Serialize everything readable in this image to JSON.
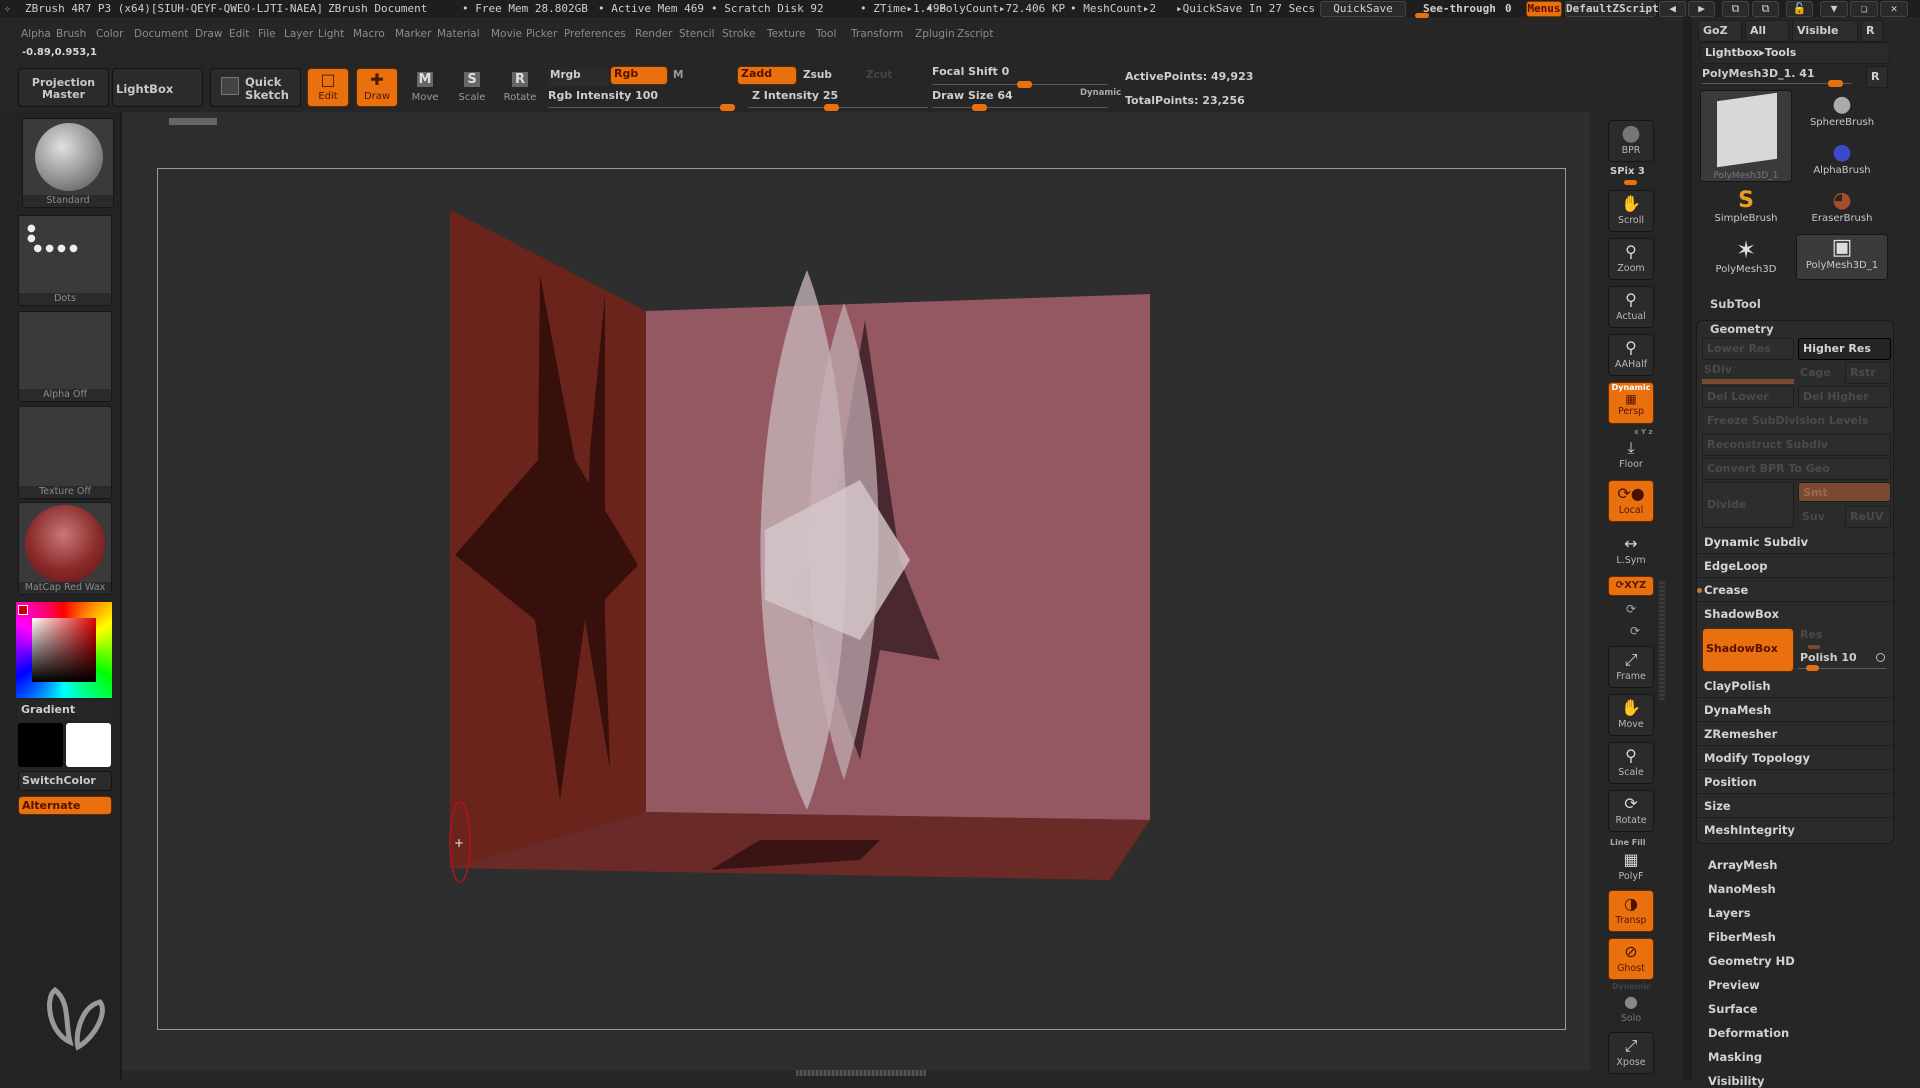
{
  "title_bar": {
    "app_title": "ZBrush 4R7 P3 (x64)[SIUH-QEYF-QWEO-LJTI-NAEA]",
    "document": "ZBrush Document",
    "free_mem": "• Free Mem 28.802GB",
    "active_mem": "• Active Mem 469",
    "scratch_disk": "• Scratch Disk 92",
    "ztime": "• ZTime▸1.496",
    "polycount": "• PolyCount▸72.406 KP",
    "meshcount": "• MeshCount▸2",
    "quicksave_status": "▸QuickSave In 27 Secs",
    "quicksave_button": "QuickSave",
    "see_through_label": "See-through",
    "see_through_value": "0",
    "menus_button": "Menus",
    "default_zscript": "DefaultZScript"
  },
  "menu_bar": [
    "Alpha",
    "Brush",
    "Color",
    "Document",
    "Draw",
    "Edit",
    "File",
    "Layer",
    "Light",
    "Macro",
    "Marker",
    "Material",
    "Movie",
    "Picker",
    "Preferences",
    "Render",
    "Stencil",
    "Stroke",
    "Texture",
    "Tool",
    "Transform",
    "Zplugin",
    "Zscript"
  ],
  "coords": "-0.89,0.953,1",
  "top_toolbar": {
    "projection_master": "Projection Master",
    "lightbox": "LightBox",
    "quick_sketch": "Quick Sketch",
    "edit": "Edit",
    "draw": "Draw",
    "move": "Move",
    "scale": "Scale",
    "rotate": "Rotate",
    "mrgb": "Mrgb",
    "rgb": "Rgb",
    "m": "M",
    "rgb_intensity_label": "Rgb Intensity 100",
    "rgb_intensity_value": 100,
    "zadd": "Zadd",
    "zsub": "Zsub",
    "zcut": "Zcut",
    "z_intensity_label": "Z Intensity 25",
    "z_intensity_value": 25,
    "focal_shift_label": "Focal Shift 0",
    "focal_shift_value": 0,
    "draw_size_label": "Draw Size 64",
    "draw_size_value": 64,
    "dynamic": "Dynamic",
    "active_points": "ActivePoints: 49,923",
    "total_points": "TotalPoints: 23,256"
  },
  "left_shelf": {
    "brush": "Standard",
    "stroke": "Dots",
    "alpha": "Alpha Off",
    "texture": "Texture Off",
    "material": "MatCap Red Wax",
    "gradient": "Gradient",
    "switch_color": "SwitchColor",
    "alternate": "Alternate",
    "main_color": "#cc0000",
    "secondary_color": "#ffffff"
  },
  "right_shelf": {
    "bpr": "BPR",
    "spix": "SPix 3",
    "scroll": "Scroll",
    "zoom": "Zoom",
    "actual": "Actual",
    "aahalf": "AAHalf",
    "persp_dynamic": "Dynamic",
    "persp": "Persp",
    "floor_axes": "x Y z",
    "floor": "Floor",
    "local": "Local",
    "lsym": "L.Sym",
    "xyz": "XYZ",
    "frame": "Frame",
    "move": "Move",
    "scale": "Scale",
    "rotate": "Rotate",
    "line_fill": "Line Fill",
    "polyf": "PolyF",
    "transp": "Transp",
    "ghost": "Ghost",
    "solo_dynamic": "Dynamic",
    "solo": "Solo",
    "xpose": "Xpose"
  },
  "tool_palette": {
    "goz": "GoZ",
    "all": "All",
    "visible": "Visible",
    "r": "R",
    "lightbox_tools": "Lightbox▸Tools",
    "current_tool": "PolyMesh3D_1. 41",
    "r_button": "R",
    "tools": [
      "PolyMesh3D_1",
      "SphereBrush",
      "AlphaBrush",
      "SimpleBrush",
      "EraserBrush",
      "PolyMesh3D",
      "PolyMesh3D_1"
    ],
    "subtool": "SubTool",
    "geometry": "Geometry",
    "lower_res": "Lower Res",
    "higher_res": "Higher Res",
    "sdiv": "SDiv",
    "cage": "Cage",
    "rstr": "Rstr",
    "del_lower": "Del Lower",
    "del_higher": "Del Higher",
    "freeze": "Freeze SubDivision Levels",
    "reconstruct": "Reconstruct Subdiv",
    "convert_bpr": "Convert BPR To Geo",
    "divide": "Divide",
    "smt": "Smt",
    "suv": "Suv",
    "reuv": "ReUV",
    "geometry_items": [
      "Dynamic Subdiv",
      "EdgeLoop",
      "Crease",
      "ShadowBox"
    ],
    "shadowbox_button": "ShadowBox",
    "res": "Res",
    "polish_label": "Polish 10",
    "polish_value": 10,
    "geometry_items_2": [
      "ClayPolish",
      "DynaMesh",
      "ZRemesher",
      "Modify Topology",
      "Position",
      "Size",
      "MeshIntegrity"
    ],
    "sections": [
      "ArrayMesh",
      "NanoMesh",
      "Layers",
      "FiberMesh",
      "Geometry HD",
      "Preview",
      "Surface",
      "Deformation",
      "Masking",
      "Visibility"
    ]
  },
  "colors": {
    "accent": "#e8700e",
    "bg": "#262626"
  }
}
